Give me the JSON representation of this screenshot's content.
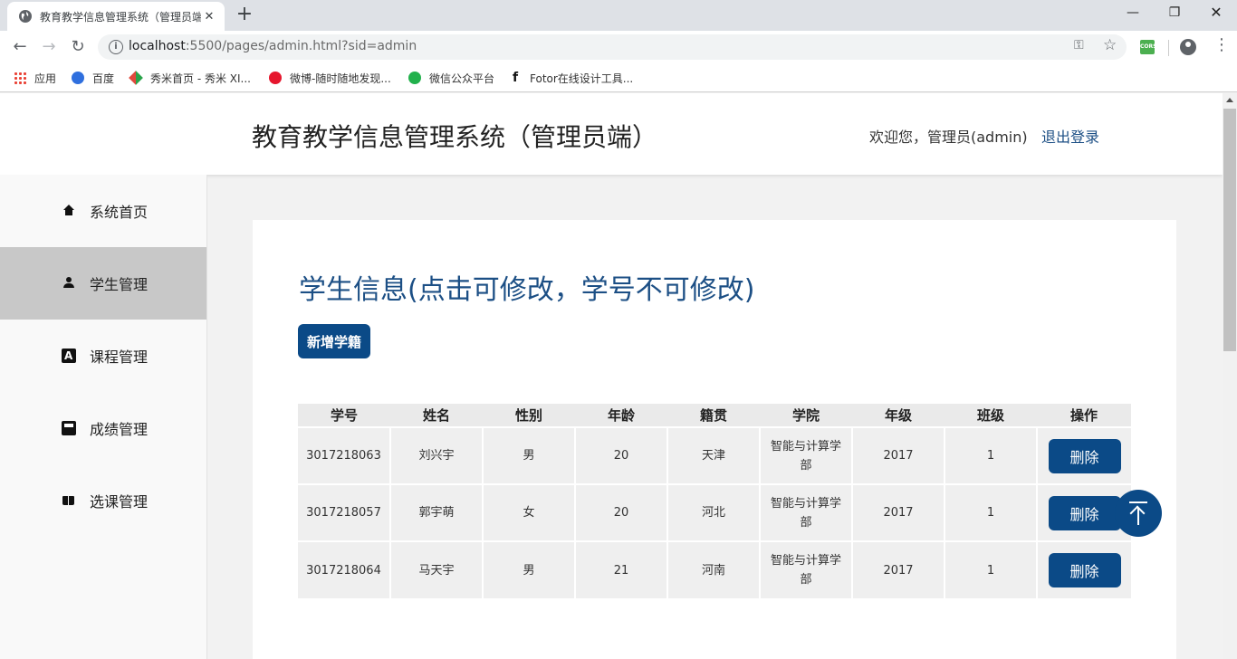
{
  "browser": {
    "tab_title": "教育教学信息管理系统（管理员端）",
    "tab_close": "✕",
    "new_tab": "+",
    "url_host": "localhost",
    "url_rest": ":5500/pages/admin.html?sid=admin",
    "window_controls": {
      "minimize": "—",
      "maximize": "❐",
      "close": "✕"
    },
    "ext_cors": "CORS",
    "bookmarks": [
      {
        "label": "应用",
        "icon": "apps-grid-icon"
      },
      {
        "label": "百度",
        "icon": "baidu-paw-icon"
      },
      {
        "label": "秀米首页 - 秀米 XI...",
        "icon": "xiumi-icon"
      },
      {
        "label": "微博-随时随地发现...",
        "icon": "weibo-icon"
      },
      {
        "label": "微信公众平台",
        "icon": "wechat-icon"
      },
      {
        "label": "Fotor在线设计工具...",
        "icon": "fotor-icon"
      }
    ]
  },
  "header": {
    "title": "教育教学信息管理系统（管理员端）",
    "welcome": "欢迎您，管理员(admin)",
    "logout": "退出登录"
  },
  "sidebar": {
    "items": [
      {
        "label": "系统首页",
        "icon": "home-icon",
        "active": false
      },
      {
        "label": "学生管理",
        "icon": "user-icon",
        "active": true
      },
      {
        "label": "课程管理",
        "icon": "course-icon",
        "active": false
      },
      {
        "label": "成绩管理",
        "icon": "score-icon",
        "active": false
      },
      {
        "label": "选课管理",
        "icon": "book-icon",
        "active": false
      }
    ]
  },
  "main": {
    "title": "学生信息(点击可修改，学号不可修改)",
    "add_button": "新增学籍",
    "table": {
      "headers": [
        "学号",
        "姓名",
        "性别",
        "年龄",
        "籍贯",
        "学院",
        "年级",
        "班级",
        "操作"
      ],
      "rows": [
        [
          "3017218063",
          "刘兴宇",
          "男",
          "20",
          "天津",
          "智能与计算学部",
          "2017",
          "1"
        ],
        [
          "3017218057",
          "郭宇萌",
          "女",
          "20",
          "河北",
          "智能与计算学部",
          "2017",
          "1"
        ],
        [
          "3017218064",
          "马天宇",
          "男",
          "21",
          "河南",
          "智能与计算学部",
          "2017",
          "1"
        ]
      ],
      "delete_label": "删除"
    }
  },
  "colors": {
    "primary": "#0b4a87",
    "title_blue": "#1c4f85",
    "active_nav": "#c8c8c8"
  }
}
